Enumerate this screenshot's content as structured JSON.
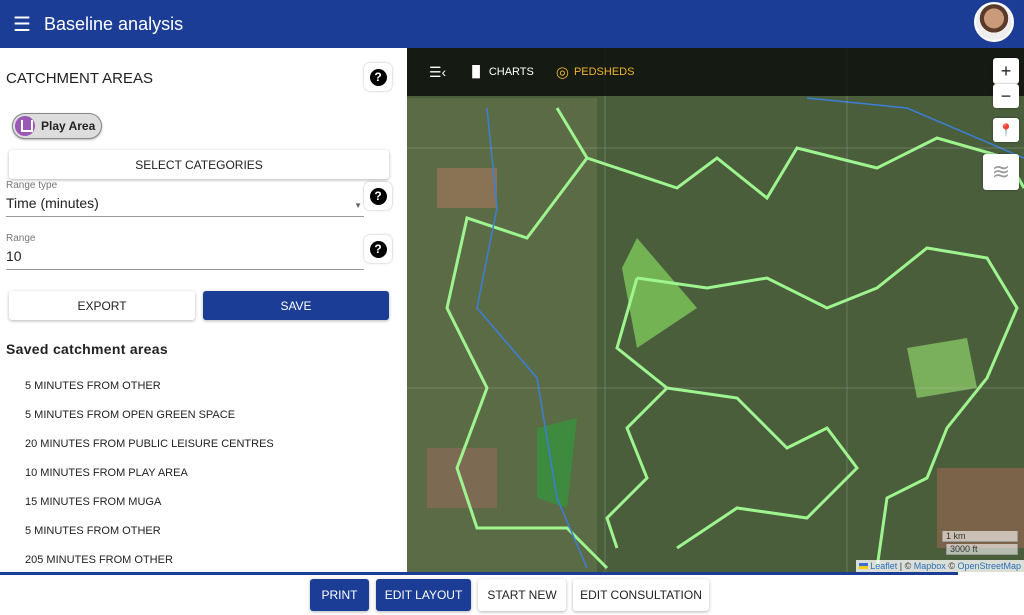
{
  "header": {
    "title": "Baseline analysis",
    "menu_icon": "menu-icon"
  },
  "panel": {
    "title": "CATCHMENT AREAS",
    "chip": "Play Area",
    "select_categories": "SELECT CATEGORIES",
    "range_type": {
      "label": "Range type",
      "value": "Time (minutes)"
    },
    "range": {
      "label": "Range",
      "value": "10"
    },
    "export": "EXPORT",
    "save": "SAVE",
    "saved_title": "Saved catchment areas",
    "saved": [
      "5 MINUTES FROM OTHER",
      "5 MINUTES FROM OPEN GREEN SPACE",
      "20 MINUTES FROM PUBLIC LEISURE CENTRES",
      "10 MINUTES FROM PLAY AREA",
      "15 MINUTES FROM MUGA",
      "5 MINUTES FROM OTHER",
      "205 MINUTES FROM OTHER"
    ]
  },
  "map": {
    "toolbar": {
      "charts": "CHARTS",
      "pedsheds": "PEDSHEDS"
    },
    "zoom_in": "+",
    "zoom_out": "−",
    "scale": {
      "metric": "1 km",
      "imperial": "3000 ft"
    },
    "attribution": {
      "leaflet": "Leaflet",
      "sep": " | © ",
      "mapbox": "Mapbox",
      "sep2": " © ",
      "osm": "OpenStreetMap"
    },
    "colors": {
      "catchment_outline": "#9ef58f",
      "accent": "#f0b429",
      "boundary": "#3b7fd6"
    }
  },
  "footer": {
    "print": "PRINT",
    "edit_layout": "EDIT LAYOUT",
    "start_new": "START NEW",
    "edit_consultation": "EDIT CONSULTATION"
  }
}
